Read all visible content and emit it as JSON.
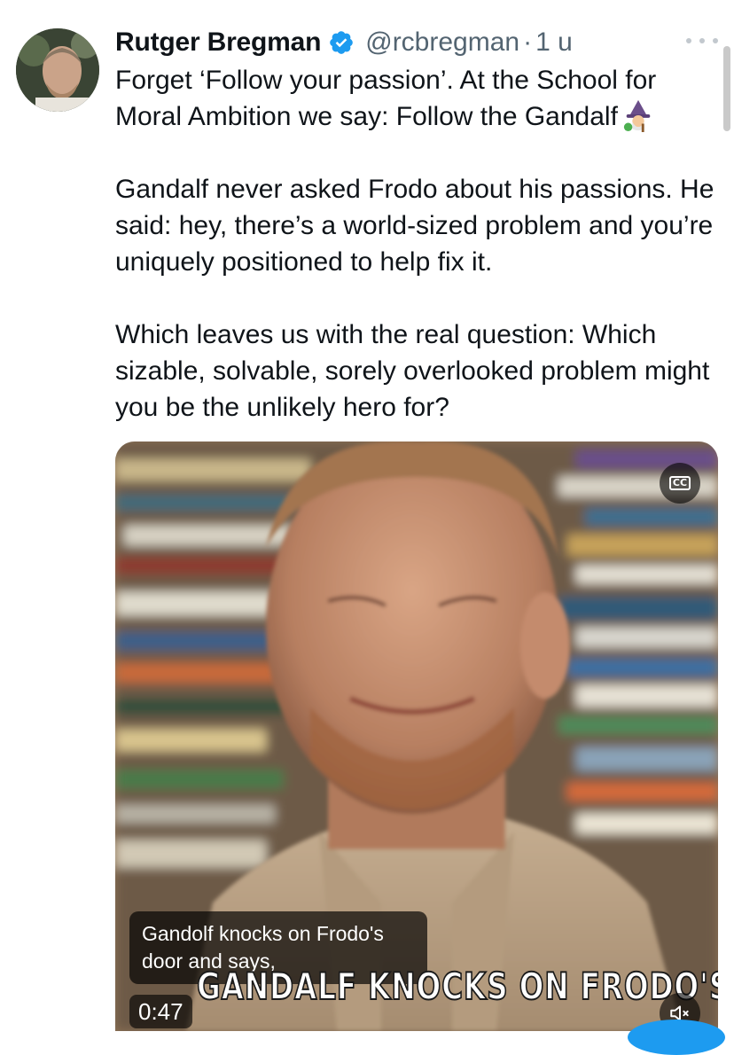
{
  "tweet": {
    "author": {
      "display_name": "Rutger Bregman",
      "handle": "@rcbregman",
      "separator": "·",
      "time_ago": "1 u",
      "verified": true
    },
    "text": {
      "line1": "Forget ‘Follow your passion’. At the School for",
      "line2": "Moral Ambition we say: Follow the Gandalf",
      "paragraph2": "Gandalf never asked Frodo about his passions. He said: hey, there’s a world-sized problem and you’re uniquely positioned to help fix it.",
      "paragraph3": "Which leaves us with the real question: Which sizable, solvable, sorely overlooked problem might you be the unlikely hero for?"
    },
    "emoji": "mage-icon"
  },
  "video": {
    "cc_label": "CC",
    "caption": "Gandolf knocks on Frodo's door and says,",
    "burned_in_text": "GANDALF KNOCKS ON FRODO'S",
    "timestamp": "0:47",
    "muted": true
  },
  "colors": {
    "text": "#0f1419",
    "secondary": "#536471",
    "verified": "#1d9bf0",
    "accent": "#1d9bf0"
  }
}
